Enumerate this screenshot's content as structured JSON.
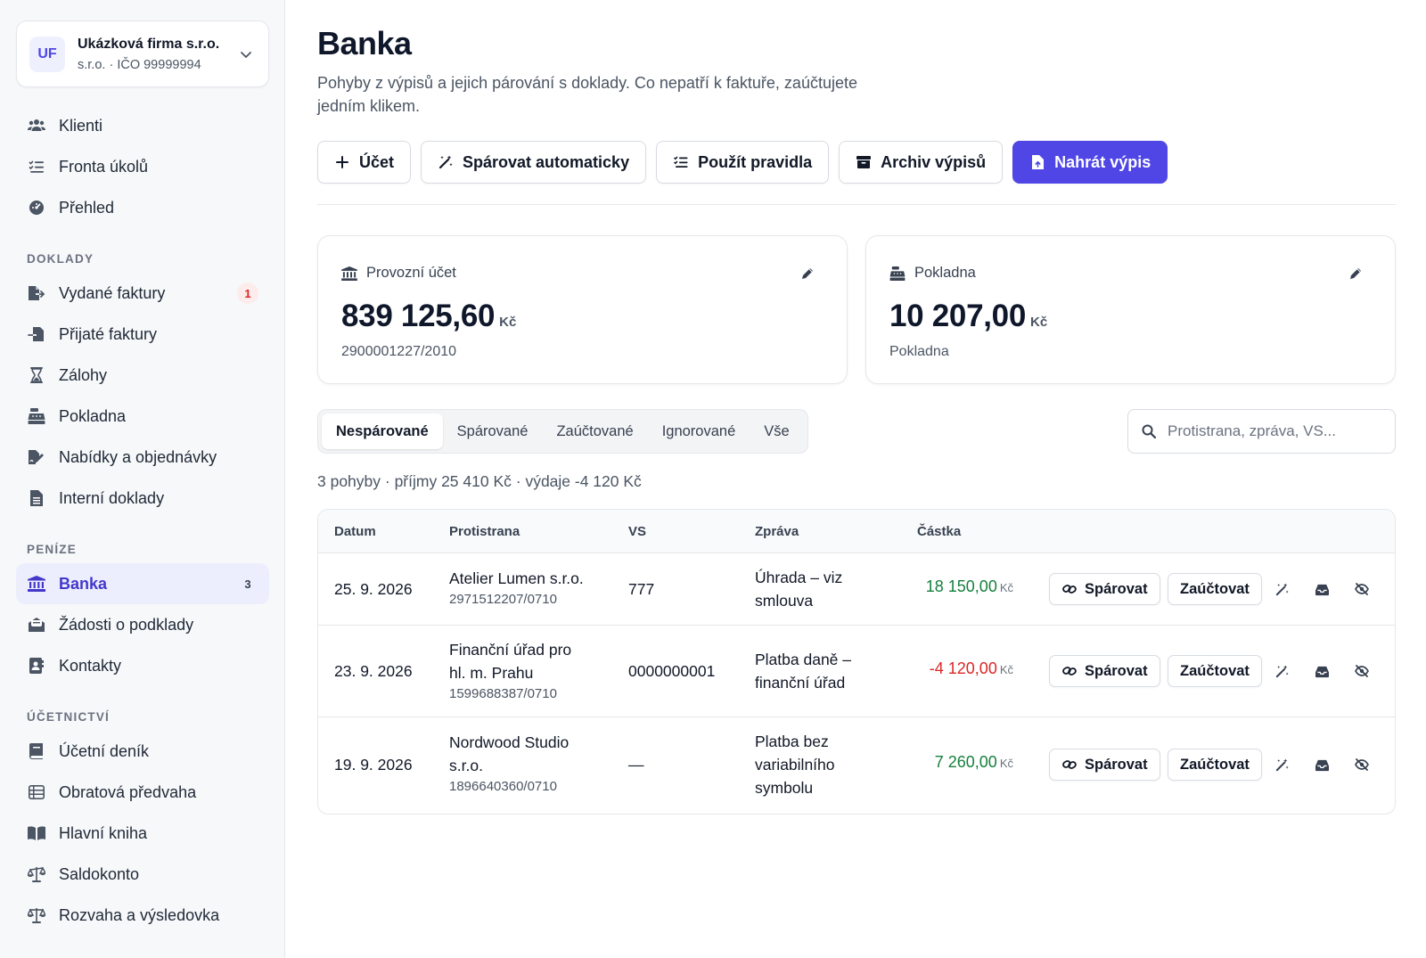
{
  "org": {
    "initials": "UF",
    "name": "Ukázková firma s.r.o.",
    "sub": "s.r.o. · IČO 99999994"
  },
  "nav": {
    "top": [
      {
        "label": "Klienti",
        "icon": "users-icon"
      },
      {
        "label": "Fronta úkolů",
        "icon": "list-check-icon"
      },
      {
        "label": "Přehled",
        "icon": "gauge-icon"
      }
    ],
    "section_doklady": "DOKLADY",
    "doklady": [
      {
        "label": "Vydané faktury",
        "icon": "file-export-icon",
        "badge": "1"
      },
      {
        "label": "Přijaté faktury",
        "icon": "file-import-icon"
      },
      {
        "label": "Zálohy",
        "icon": "hourglass-icon"
      },
      {
        "label": "Pokladna",
        "icon": "cash-register-icon"
      },
      {
        "label": "Nabídky a objednávky",
        "icon": "file-signature-icon"
      },
      {
        "label": "Interní doklady",
        "icon": "file-lines-icon"
      }
    ],
    "section_penize": "PENÍZE",
    "penize": [
      {
        "label": "Banka",
        "icon": "bank-icon",
        "badge": "3",
        "active": true
      },
      {
        "label": "Žádosti o podklady",
        "icon": "envelope-open-icon"
      },
      {
        "label": "Kontakty",
        "icon": "address-book-icon"
      }
    ],
    "section_ucetnictvi": "ÚČETNICTVÍ",
    "ucetnictvi": [
      {
        "label": "Účetní deník",
        "icon": "book-icon"
      },
      {
        "label": "Obratová předvaha",
        "icon": "table-list-icon"
      },
      {
        "label": "Hlavní kniha",
        "icon": "book-open-icon"
      },
      {
        "label": "Saldokonto",
        "icon": "scale-icon"
      },
      {
        "label": "Rozvaha a výsledovka",
        "icon": "scale-balanced-icon"
      }
    ]
  },
  "page": {
    "title": "Banka",
    "description": "Pohyby z výpisů a jejich párování s doklady. Co nepatří k faktuře, zaúčtujete jedním klikem."
  },
  "toolbar": {
    "add_account": "Účet",
    "auto_match": "Spárovat automaticky",
    "apply_rules": "Použít pravidla",
    "archive": "Archiv výpisů",
    "upload": "Nahrát výpis"
  },
  "accounts": [
    {
      "name": "Provozní účet",
      "amount": "839 125,60",
      "currency": "Kč",
      "number": "2900001227/2010"
    },
    {
      "name": "Pokladna",
      "amount": "10 207,00",
      "currency": "Kč",
      "number": "Pokladna"
    }
  ],
  "tabs": [
    "Nespárované",
    "Spárované",
    "Zaúčtované",
    "Ignorované",
    "Vše"
  ],
  "active_tab": "Nespárované",
  "search": {
    "placeholder": "Protistrana, zpráva, VS..."
  },
  "summary": "3 pohyby · příjmy 25 410 Kč · výdaje -4 120 Kč",
  "table": {
    "headers": {
      "date": "Datum",
      "counterparty": "Protistrana",
      "vs": "VS",
      "message": "Zpráva",
      "amount": "Částka"
    },
    "actions": {
      "match": "Spárovat",
      "post": "Zaúčtovat"
    },
    "rows": [
      {
        "date": "25. 9. 2026",
        "counterparty_l1": "Atelier Lumen s.r.o.",
        "counterparty_l2": "",
        "account": "2971512207/0710",
        "vs": "777",
        "message_l1": "Úhrada – viz",
        "message_l2": "smlouva",
        "message_l3": "",
        "amount": "18 150,00",
        "currency": "Kč",
        "sign": "pos"
      },
      {
        "date": "23. 9. 2026",
        "counterparty_l1": "Finanční úřad pro",
        "counterparty_l2": "hl. m. Prahu",
        "account": "1599688387/0710",
        "vs": "0000000001",
        "message_l1": "Platba daně –",
        "message_l2": "finanční úřad",
        "message_l3": "",
        "amount": "-4 120,00",
        "currency": "Kč",
        "sign": "neg"
      },
      {
        "date": "19. 9. 2026",
        "counterparty_l1": "Nordwood Studio",
        "counterparty_l2": "s.r.o.",
        "account": "1896640360/0710",
        "vs": "—",
        "message_l1": "Platba bez",
        "message_l2": "variabilního",
        "message_l3": "symbolu",
        "amount": "7 260,00",
        "currency": "Kč",
        "sign": "pos"
      }
    ]
  },
  "colors": {
    "accent": "#4f46e5",
    "positive": "#15803d",
    "negative": "#dc2626"
  }
}
